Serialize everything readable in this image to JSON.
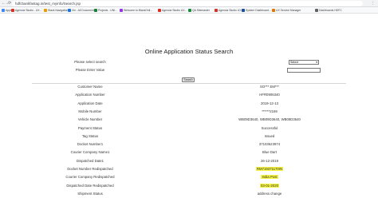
{
  "browser": {
    "url": "hdfcbankfastag.in/test_myinfo/Search.jsp",
    "back": "←",
    "forward": "→",
    "reload": "⟳",
    "menu": "⋮"
  },
  "bookmarks": [
    {
      "label": "Apps",
      "color": "#4285f4"
    },
    {
      "label": "Agencia Studio - UX...",
      "color": "#d93025"
    },
    {
      "label": "Stack Navigation...",
      "color": "#f29900"
    },
    {
      "label": "Vin - All Documents",
      "color": "#1a73e8"
    },
    {
      "label": "Projects - UNI...",
      "color": "#188038"
    },
    {
      "label": "Welcome to iBankOnli...",
      "color": "#9334e6"
    },
    {
      "label": "Agencia Studio UX...",
      "color": "#d93025"
    },
    {
      "label": "QA Sitemaster",
      "color": "#1e8e3e"
    },
    {
      "label": "Agencia Studio UX...",
      "color": "#d93025"
    },
    {
      "label": "System Dashboard...",
      "color": "#174ea6"
    },
    {
      "label": "UX Service Manager",
      "color": "#e37400"
    },
    {
      "label": "Dashboards HDFC",
      "color": "#5f6368"
    }
  ],
  "page": {
    "title": "Online Application Status Search",
    "search_label": "Please select search",
    "select_value": "Select",
    "value_label": "Please Enter Value",
    "search_button": "Search"
  },
  "details": [
    {
      "label": "Customer Name",
      "value": "SO*** EM***",
      "highlight": false
    },
    {
      "label": "Application Number",
      "value": "HFR0906340",
      "highlight": false
    },
    {
      "label": "Application Date",
      "value": "2019-12-13",
      "highlight": false
    },
    {
      "label": "Mobile Number",
      "value": "******2169",
      "highlight": false
    },
    {
      "label": "Vehicle Number",
      "value": "WB09D3640, WB09D3640, WB09D3640",
      "highlight": false
    },
    {
      "label": "Payment Status",
      "value": "Successful",
      "highlight": false
    },
    {
      "label": "Tag Status",
      "value": "Issued",
      "highlight": false
    },
    {
      "label": "Docket Number1",
      "value": "37103623974",
      "highlight": false
    },
    {
      "label": "Courier Company Name1",
      "value": "Blue Dart",
      "highlight": false
    },
    {
      "label": "Dispatched Date1",
      "value": "26-12-2019",
      "highlight": false
    },
    {
      "label": "Docket Number Redispatched",
      "value": "RM719371170IN",
      "highlight": true
    },
    {
      "label": "Courier Company Redispatched",
      "value": "India Post",
      "highlight": true
    },
    {
      "label": "Dispatched Date Redispatched",
      "value": "03-01-2020",
      "highlight": true
    },
    {
      "label": "Shipment Status",
      "value": "address change",
      "highlight": false
    }
  ]
}
